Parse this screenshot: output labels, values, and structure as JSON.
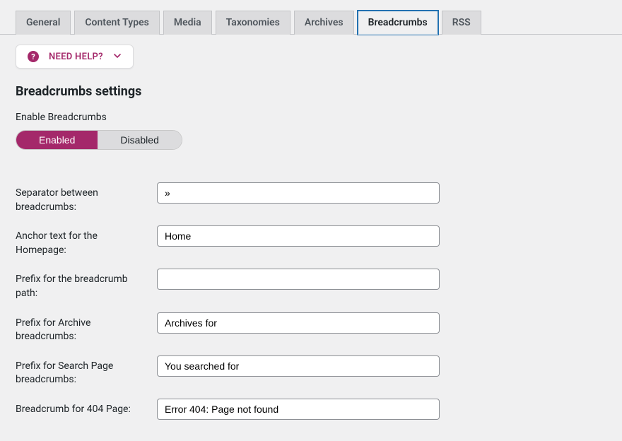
{
  "tabs": [
    {
      "label": "General"
    },
    {
      "label": "Content Types"
    },
    {
      "label": "Media"
    },
    {
      "label": "Taxonomies"
    },
    {
      "label": "Archives"
    },
    {
      "label": "Breadcrumbs"
    },
    {
      "label": "RSS"
    }
  ],
  "help": {
    "label": "NEED HELP?"
  },
  "section": {
    "title": "Breadcrumbs settings",
    "enable_label": "Enable Breadcrumbs",
    "toggle_enabled": "Enabled",
    "toggle_disabled": "Disabled"
  },
  "fields": {
    "separator": {
      "label": "Separator between breadcrumbs:",
      "value": "»"
    },
    "anchor": {
      "label": "Anchor text for the Homepage:",
      "value": "Home"
    },
    "prefix_path": {
      "label": "Prefix for the breadcrumb path:",
      "value": ""
    },
    "prefix_archive": {
      "label": "Prefix for Archive breadcrumbs:",
      "value": "Archives for"
    },
    "prefix_search": {
      "label": "Prefix for Search Page breadcrumbs:",
      "value": "You searched for"
    },
    "page_404": {
      "label": "Breadcrumb for 404 Page:",
      "value": "Error 404: Page not found"
    }
  }
}
